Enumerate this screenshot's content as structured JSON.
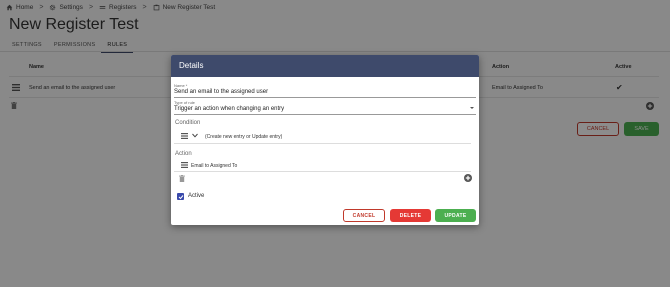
{
  "breadcrumb": {
    "home": "Home",
    "settings": "Settings",
    "registers": "Registers",
    "current": "New Register Test",
    "separator": ">"
  },
  "page": {
    "title": "New Register Test"
  },
  "tabs": [
    {
      "label": "SETTINGS"
    },
    {
      "label": "PERMISSIONS"
    },
    {
      "label": "RULES"
    }
  ],
  "table": {
    "headers": {
      "name": "Name",
      "action": "Action",
      "active": "Active"
    },
    "rows": [
      {
        "name": "Send an email to the assigned user",
        "action": "Email to Assigned To",
        "active": "✔"
      }
    ]
  },
  "page_buttons": {
    "cancel": "CANCEL",
    "save": "SAVE"
  },
  "dialog": {
    "title": "Details",
    "name_label": "Name *",
    "name_value": "Send an email to the assigned user",
    "type_label": "Type of rule",
    "type_value": "Trigger an action when changing an entry",
    "condition_title": "Condition",
    "condition_text": "(Create new entry or Update entry)",
    "action_title": "Action",
    "action_text": "Email to Assigned To",
    "active_label": "Active",
    "active_checked": true,
    "buttons": {
      "cancel": "CANCEL",
      "delete": "DELETE",
      "update": "UPDATE"
    }
  },
  "colors": {
    "header": "#3e4a6b",
    "accent_green": "#4caf50",
    "danger": "#e53935",
    "checkbox": "#3949ab"
  }
}
